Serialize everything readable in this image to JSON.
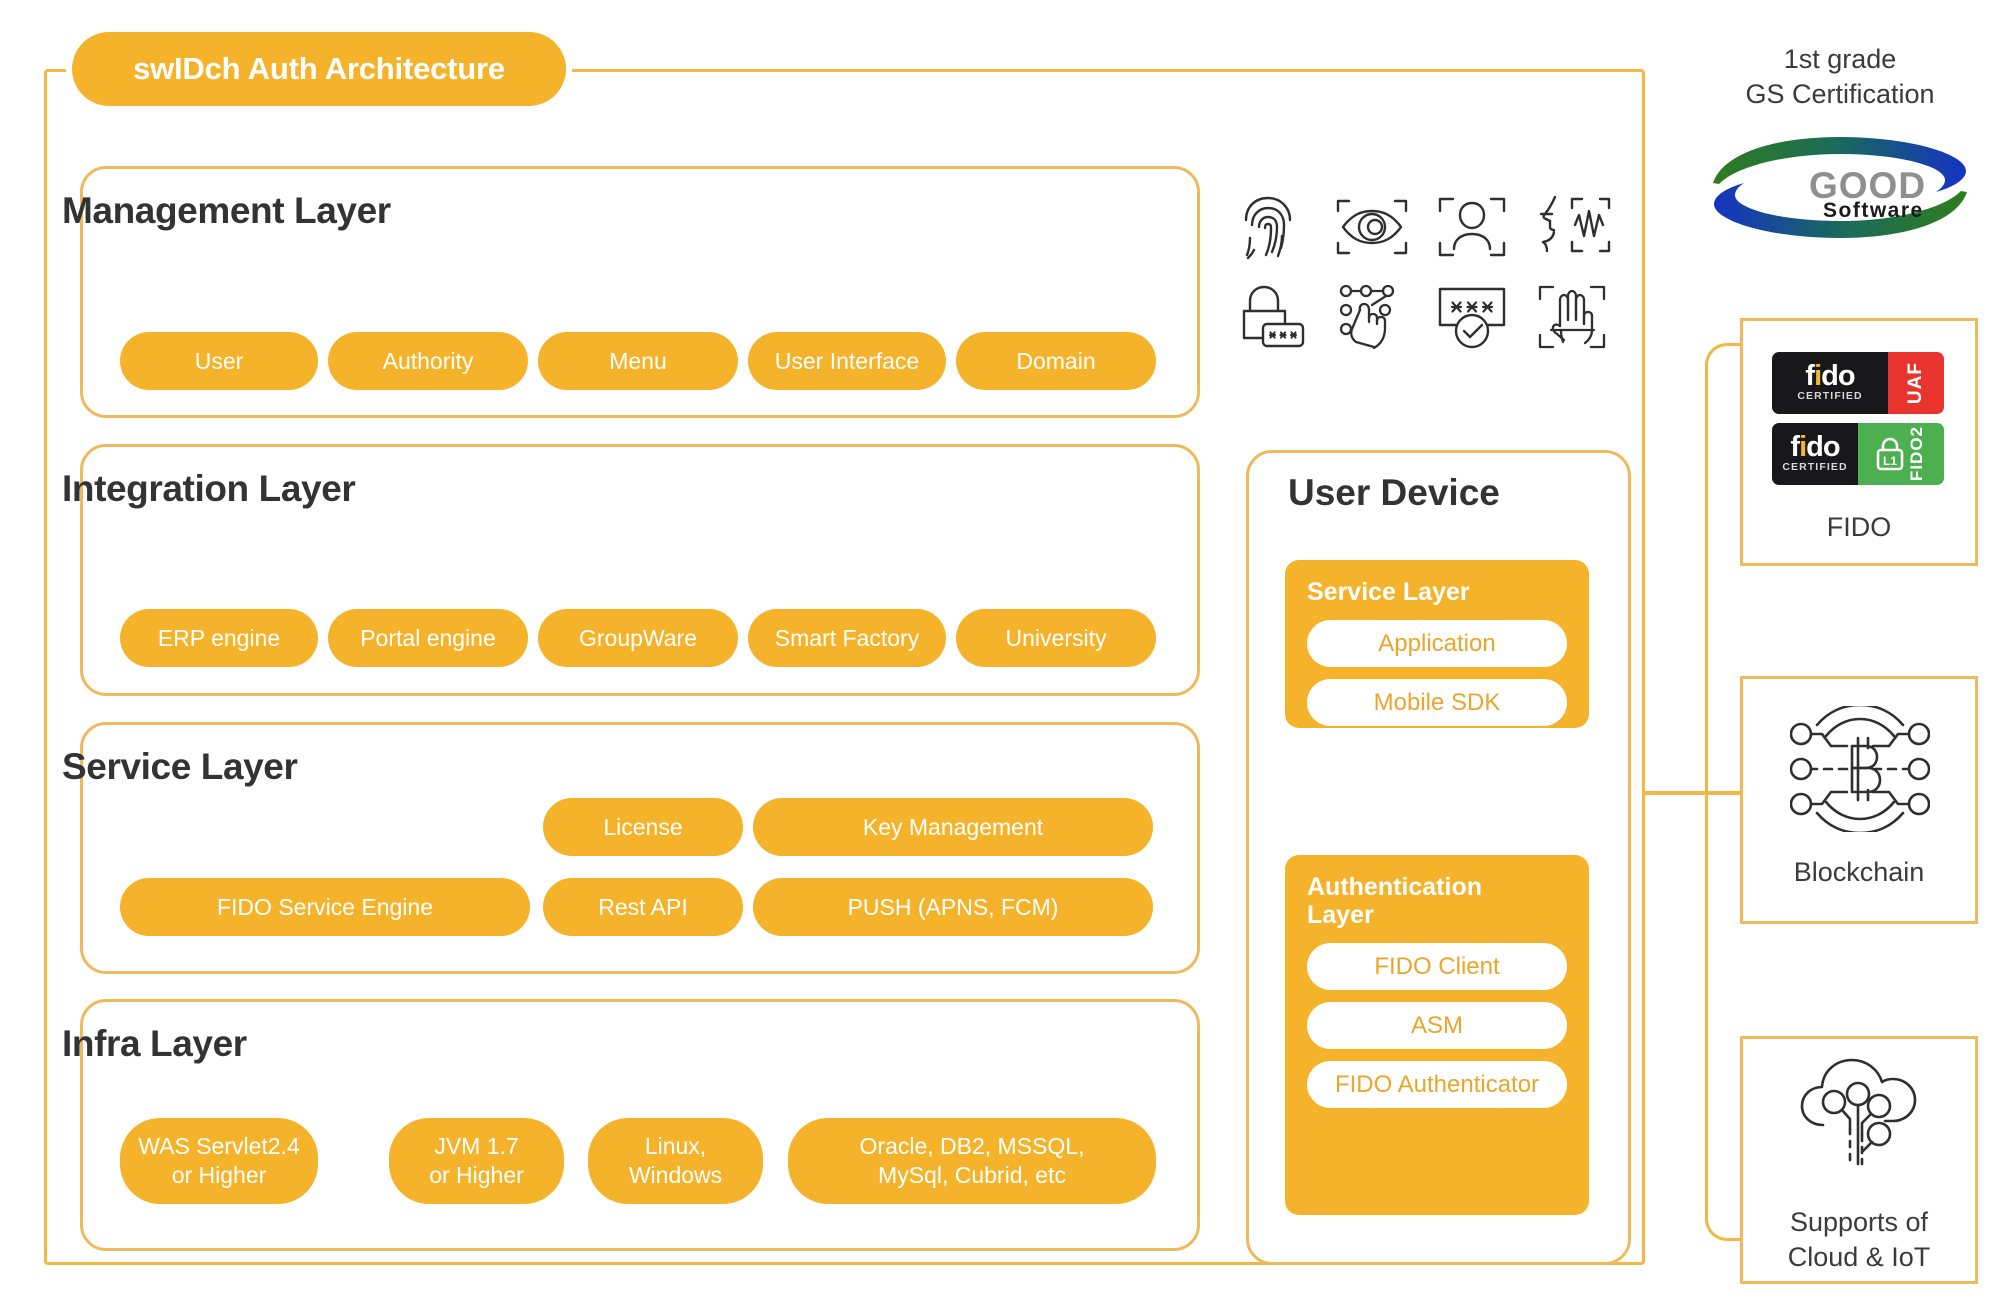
{
  "diagram": {
    "title": "swIDch Auth Architecture"
  },
  "layers": [
    {
      "id": "management",
      "title": "Management Layer",
      "pills": [
        {
          "label": "User"
        },
        {
          "label": "Authority"
        },
        {
          "label": "Menu"
        },
        {
          "label": "User Interface"
        },
        {
          "label": "Domain"
        }
      ]
    },
    {
      "id": "integration",
      "title": "Integration Layer",
      "pills": [
        {
          "label": "ERP engine"
        },
        {
          "label": "Portal engine"
        },
        {
          "label": "GroupWare"
        },
        {
          "label": "Smart Factory"
        },
        {
          "label": "University"
        }
      ]
    },
    {
      "id": "service",
      "title": "Service Layer",
      "pills_row1": [
        {
          "label": "License"
        },
        {
          "label": "Key Management"
        }
      ],
      "pills_row2": [
        {
          "label": "FIDO Service Engine"
        },
        {
          "label": "Rest API"
        },
        {
          "label": "PUSH (APNS, FCM)"
        }
      ]
    },
    {
      "id": "infra",
      "title": "Infra Layer",
      "pills": [
        {
          "line1": "WAS Servlet2.4",
          "line2": "or Higher"
        },
        {
          "line1": "JVM 1.7",
          "line2": "or Higher"
        },
        {
          "line1": "Linux,",
          "line2": "Windows"
        },
        {
          "line1": "Oracle, DB2, MSSQL,",
          "line2": "MySql, Cubrid, etc"
        }
      ]
    }
  ],
  "user_device": {
    "title": "User Device",
    "groups": [
      {
        "title": "Service Layer",
        "items": [
          {
            "label": "Application"
          },
          {
            "label": "Mobile SDK"
          }
        ]
      },
      {
        "title": "Authentication Layer",
        "items": [
          {
            "label": "FIDO Client"
          },
          {
            "label": "ASM"
          },
          {
            "label": "FIDO Authenticator"
          }
        ]
      }
    ]
  },
  "biometric_icons": [
    {
      "name": "fingerprint-icon"
    },
    {
      "name": "iris-scan-icon"
    },
    {
      "name": "face-recognition-icon"
    },
    {
      "name": "voice-recognition-icon"
    },
    {
      "name": "password-lock-icon"
    },
    {
      "name": "pattern-touch-icon"
    },
    {
      "name": "pin-verified-icon"
    },
    {
      "name": "palm-scan-icon"
    }
  ],
  "certifications": {
    "gs": {
      "caption_line1": "1st grade",
      "caption_line2": "GS Certification",
      "logo_word_top": "GOOD",
      "logo_word_bottom": "Software"
    },
    "boxes": [
      {
        "id": "fido",
        "label": "FIDO",
        "badges": [
          {
            "word": "fido",
            "cert": "CERTIFIED",
            "variant": "UAF",
            "color": "#E8342C"
          },
          {
            "word": "fido",
            "cert": "CERTIFIED",
            "variant": "FIDO2",
            "level": "L1",
            "color": "#4CAF50"
          }
        ]
      },
      {
        "id": "blockchain",
        "label": "Blockchain",
        "icon": "blockchain-bitcoin-nodes-icon"
      },
      {
        "id": "cloud-iot",
        "label_line1": "Supports of",
        "label_line2": "Cloud & IoT",
        "icon": "cloud-iot-icon"
      }
    ]
  },
  "colors": {
    "accent_fill": "#F5B32B",
    "accent_border": "#EFBA5C",
    "frame_border": "#F0B846",
    "text_dark": "#333333",
    "pill_text": "#FFFFFF",
    "device_item_text": "#EAA62B",
    "icon_stroke": "#2F2F2F"
  }
}
